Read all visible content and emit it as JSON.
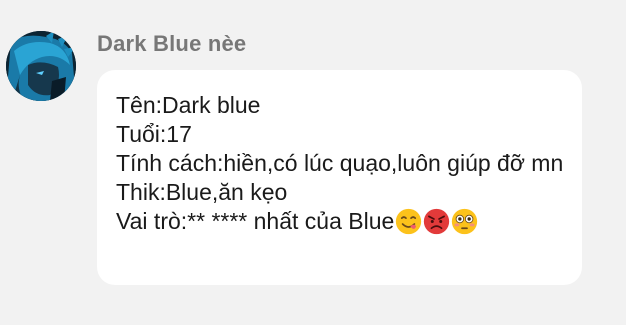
{
  "message": {
    "sender_name": "Dark Blue nèe",
    "lines": [
      "Tên:Dark blue",
      "Tuổi:17",
      "Tính cách:hiền,có lúc quạo,luôn giúp đỡ mn",
      "Thik:Blue,ăn kẹo",
      "Vai trò:** **** nhất của Blue"
    ],
    "emojis": [
      "savoring-food-emoji",
      "angry-face-emoji",
      "flushed-face-emoji"
    ]
  },
  "colors": {
    "background": "#f2f2f2",
    "bubble": "#ffffff",
    "sender_name": "#777777",
    "text": "#1a1a1a"
  }
}
